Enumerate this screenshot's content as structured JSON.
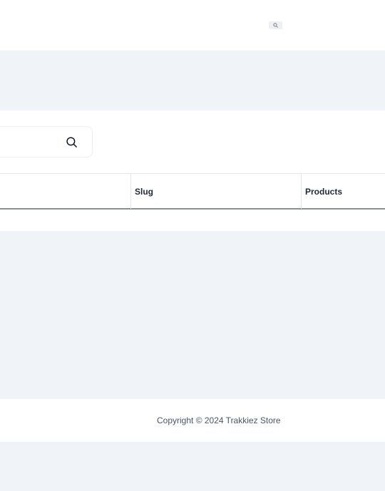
{
  "header": {
    "search_shortcut_icon": "search-icon"
  },
  "search": {
    "placeholder": "",
    "icon": "search-icon"
  },
  "table": {
    "columns": [
      {
        "label": "",
        "sortable": true,
        "active_color": "#2563eb"
      },
      {
        "label": "Slug"
      },
      {
        "label": "Products"
      }
    ],
    "rows": []
  },
  "footer": {
    "copyright": "Copyright © 2024 Trakkiez Store"
  },
  "colors": {
    "page_background": "#f0f4f8",
    "surface": "#ffffff",
    "accent": "#2563eb"
  }
}
